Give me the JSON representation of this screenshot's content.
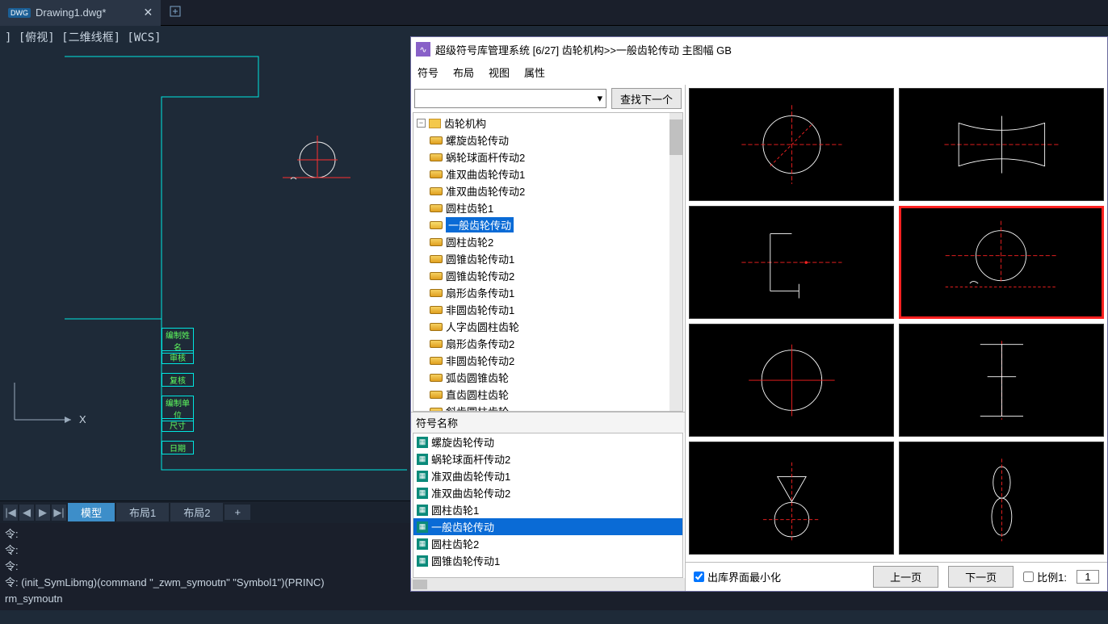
{
  "tab": {
    "badge": "DWG",
    "title": "Drawing1.dwg*",
    "add": "+"
  },
  "viewport_label": "] [俯视] [二维线框] [WCS]",
  "ucs": {
    "x": "X"
  },
  "side_labels": [
    "编制姓名",
    "审核",
    "复核",
    "编制单位",
    "尺寸",
    "日期"
  ],
  "layout_tabs": {
    "nav": [
      "|◀",
      "◀",
      "▶",
      "▶|"
    ],
    "model": "模型",
    "layout1": "布局1",
    "layout2": "布局2",
    "add": "+"
  },
  "cmd": {
    "l1": "令:",
    "l2": "令:",
    "l3": "令:",
    "l4": "令: (init_SymLibmg)(command \"_zwm_symoutn\" \"Symbol1\")(PRINC)",
    "l5": "rm_symoutn"
  },
  "lib": {
    "title": "超级符号库管理系统 [6/27] 齿轮机构>>一般齿轮传动 主图幅 GB",
    "menu": [
      "符号",
      "布局",
      "视图",
      "属性"
    ],
    "search_btn": "查找下一个",
    "tree_root": "齿轮机构",
    "tree_items": [
      "螺旋齿轮传动",
      "蜗轮球面杆传动2",
      "准双曲齿轮传动1",
      "准双曲齿轮传动2",
      "圆柱齿轮1",
      "一般齿轮传动",
      "圆柱齿轮2",
      "圆锥齿轮传动1",
      "圆锥齿轮传动2",
      "扇形齿条传动1",
      "非圆齿轮传动1",
      "人字齿圆柱齿轮",
      "扇形齿条传动2",
      "非圆齿轮传动2",
      "弧齿圆锥齿轮",
      "直齿圆柱齿轮",
      "斜齿圆柱齿轮"
    ],
    "tree_selected_index": 5,
    "symname_header": "符号名称",
    "symlist": [
      "螺旋齿轮传动",
      "蜗轮球面杆传动2",
      "准双曲齿轮传动1",
      "准双曲齿轮传动2",
      "圆柱齿轮1",
      "一般齿轮传动",
      "圆柱齿轮2",
      "圆锥齿轮传动1"
    ],
    "symlist_selected_index": 5,
    "footer": {
      "min_checkbox": "出库界面最小化",
      "prev": "上一页",
      "next": "下一页",
      "ratio_label": "比例1:",
      "ratio_value": "1"
    }
  }
}
